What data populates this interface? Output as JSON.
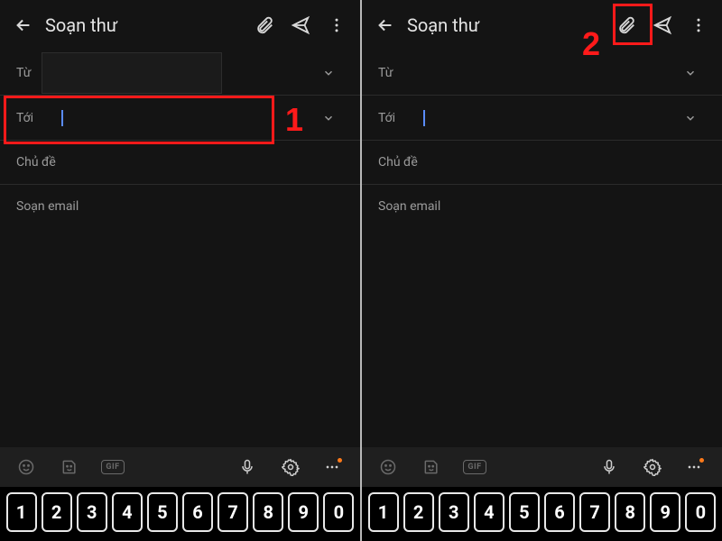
{
  "left": {
    "header": {
      "title": "Soạn thư"
    },
    "from_label": "Từ",
    "to_label": "Tới",
    "subject_placeholder": "Chủ đề",
    "body_placeholder": "Soạn email",
    "suggest": {
      "gif_label": "GIF"
    },
    "keys": [
      "1",
      "2",
      "3",
      "4",
      "5",
      "6",
      "7",
      "8",
      "9",
      "0"
    ],
    "annotation": {
      "number": "1"
    }
  },
  "right": {
    "header": {
      "title": "Soạn thư"
    },
    "from_label": "Từ",
    "to_label": "Tới",
    "subject_placeholder": "Chủ đề",
    "body_placeholder": "Soạn email",
    "suggest": {
      "gif_label": "GIF"
    },
    "keys": [
      "1",
      "2",
      "3",
      "4",
      "5",
      "6",
      "7",
      "8",
      "9",
      "0"
    ],
    "annotation": {
      "number": "2"
    }
  },
  "icons": {
    "back": "back-arrow-icon",
    "attach": "attachment-icon",
    "send": "send-icon",
    "more": "more-vert-icon",
    "chevron": "chevron-down-icon",
    "emoji": "emoji-icon",
    "sticker": "sticker-icon",
    "gif": "gif-icon",
    "mic": "mic-icon",
    "gear": "gear-icon",
    "dots": "more-horiz-icon"
  }
}
